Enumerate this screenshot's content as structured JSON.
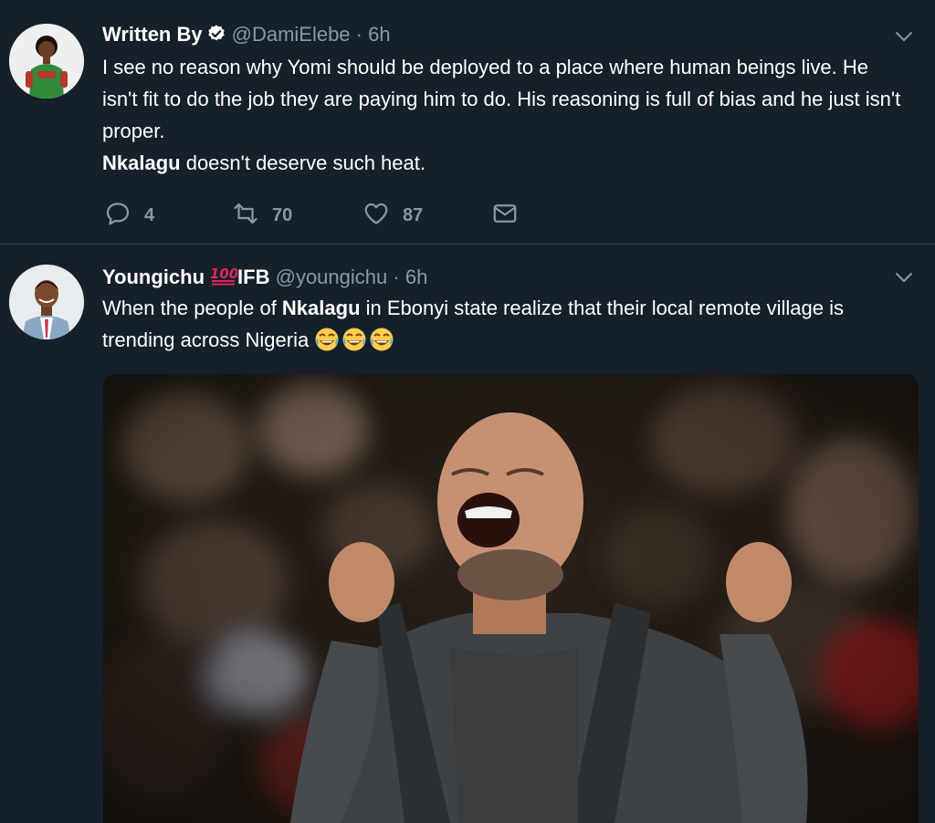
{
  "tweets": [
    {
      "display_name": "Written By",
      "handle": "@DamiElebe",
      "separator": "·",
      "time": "6h",
      "lines": [
        "I see no reason why Yomi should be deployed to a place where human beings live. He isn't fit to do the job they are paying him to do. His reasoning is full of bias and he just isn't proper."
      ],
      "line2_bold": "Nkalagu",
      "line2_rest": " doesn't deserve such heat.",
      "actions": {
        "replies": "4",
        "retweets": "70",
        "likes": "87"
      }
    },
    {
      "display_name": "Youngichu",
      "name_suffix": "IFB",
      "handle": "@youngichu",
      "separator": "·",
      "time": "6h",
      "text_before": "When the people of ",
      "text_bold": "Nkalagu",
      "text_after": " in Ebonyi state realize that their local remote village is trending across Nigeria "
    }
  ],
  "icons": {
    "verified": "verified-badge-icon",
    "caret": "chevron-down-icon",
    "reply": "reply-icon",
    "retweet": "retweet-icon",
    "like": "heart-icon",
    "dm": "envelope-icon",
    "hundred": "hundred-points-emoji",
    "laugh": "face-with-tears-of-joy-emoji"
  },
  "colors": {
    "background": "#15202b",
    "secondary_text": "#8899a6",
    "divider": "#38444d"
  }
}
